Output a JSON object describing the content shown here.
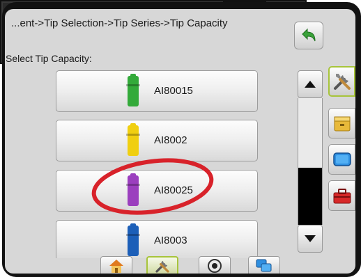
{
  "header": {
    "breadcrumb": "...ent->Tip Selection->Tip Series->Tip Capacity",
    "back_icon": "back-arrow-icon"
  },
  "main": {
    "label": "Select Tip Capacity:",
    "tips": [
      {
        "label": "AI80015",
        "color": "#33aa3a"
      },
      {
        "label": "AI8002",
        "color": "#f0cf10"
      },
      {
        "label": "AI80025",
        "color": "#9b3fbe"
      },
      {
        "label": "AI8003",
        "color": "#1c5fb8"
      }
    ]
  },
  "scrollbar": {
    "up_icon": "triangle-up-icon",
    "down_icon": "triangle-down-icon"
  },
  "side_icons": [
    {
      "name": "tools-icon",
      "active": true
    },
    {
      "name": "filing-cabinet-icon",
      "active": false
    },
    {
      "name": "display-icon",
      "active": false
    },
    {
      "name": "toolbox-icon",
      "active": false
    }
  ],
  "bottom_bar": [
    {
      "name": "home-icon",
      "active": false
    },
    {
      "name": "tools-icon",
      "active": true
    },
    {
      "name": "camera-icon",
      "active": false
    },
    {
      "name": "multi-screen-icon",
      "active": false
    }
  ],
  "colors": {
    "highlight": "#d8222a",
    "active_border": "#a7c43a",
    "back_arrow": "#3aa23a"
  }
}
